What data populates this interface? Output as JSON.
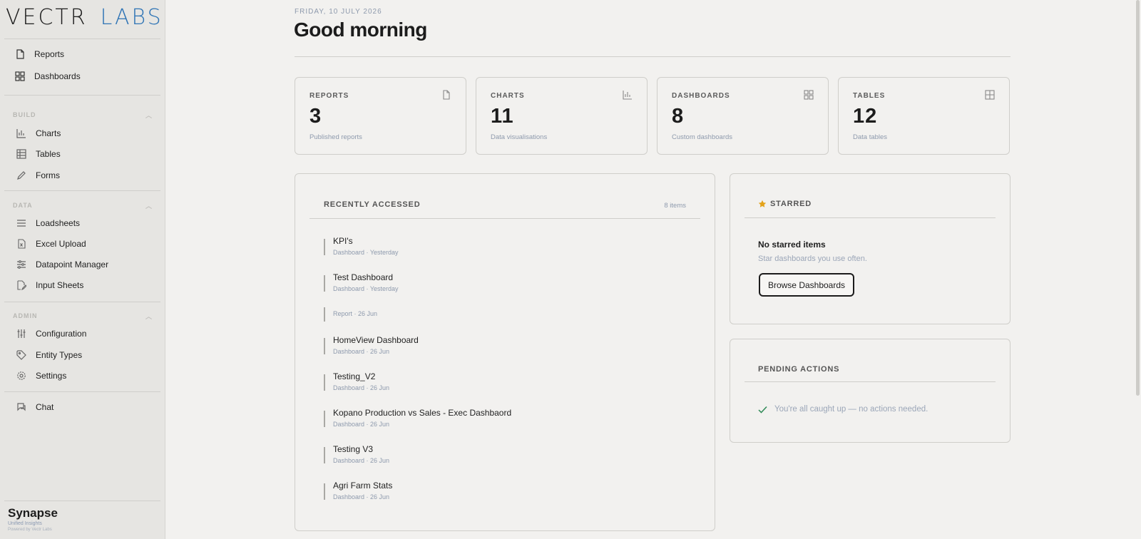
{
  "brand": {
    "logo_left": "VECTR",
    "logo_right": "LABS",
    "app_name": "Synapse",
    "tagline": "Unified Insights",
    "powered_by": "Powered by Vectr Labs"
  },
  "sidebar": {
    "top_items": [
      {
        "label": "Reports",
        "icon": "document-icon"
      },
      {
        "label": "Dashboards",
        "icon": "grid-icon"
      }
    ],
    "sections": [
      {
        "title": "BUILD",
        "items": [
          {
            "label": "Charts",
            "icon": "bar-chart-icon"
          },
          {
            "label": "Tables",
            "icon": "table-icon"
          },
          {
            "label": "Forms",
            "icon": "pencil-icon"
          }
        ]
      },
      {
        "title": "DATA",
        "items": [
          {
            "label": "Loadsheets",
            "icon": "list-icon"
          },
          {
            "label": "Excel Upload",
            "icon": "excel-file-icon"
          },
          {
            "label": "Datapoint Manager",
            "icon": "sliders-icon"
          },
          {
            "label": "Input Sheets",
            "icon": "edit-file-icon"
          }
        ]
      },
      {
        "title": "ADMIN",
        "items": [
          {
            "label": "Configuration",
            "icon": "config-sliders-icon"
          },
          {
            "label": "Entity Types",
            "icon": "tag-icon"
          },
          {
            "label": "Settings",
            "icon": "gear-icon"
          }
        ]
      }
    ],
    "chat": {
      "label": "Chat",
      "icon": "chat-icon"
    }
  },
  "header": {
    "date": "FRIDAY, 10 JULY 2026",
    "greeting": "Good morning"
  },
  "stats": [
    {
      "label": "REPORTS",
      "value": "3",
      "sub": "Published reports",
      "icon": "document-icon"
    },
    {
      "label": "CHARTS",
      "value": "11",
      "sub": "Data visualisations",
      "icon": "bar-chart-icon"
    },
    {
      "label": "DASHBOARDS",
      "value": "8",
      "sub": "Custom dashboards",
      "icon": "grid-icon"
    },
    {
      "label": "TABLES",
      "value": "12",
      "sub": "Data tables",
      "icon": "table-icon"
    }
  ],
  "recent": {
    "title": "RECENTLY ACCESSED",
    "count": "8 items",
    "items": [
      {
        "title": "KPI's",
        "meta": "Dashboard · Yesterday"
      },
      {
        "title": "Test Dashboard",
        "meta": "Dashboard · Yesterday"
      },
      {
        "title": "",
        "meta": "Report · 26 Jun"
      },
      {
        "title": "HomeView Dashboard",
        "meta": "Dashboard · 26 Jun"
      },
      {
        "title": "Testing_V2",
        "meta": "Dashboard · 26 Jun"
      },
      {
        "title": "Kopano Production vs Sales - Exec Dashbaord",
        "meta": "Dashboard · 26 Jun"
      },
      {
        "title": "Testing V3",
        "meta": "Dashboard · 26 Jun"
      },
      {
        "title": "Agri Farm Stats",
        "meta": "Dashboard · 26 Jun"
      }
    ]
  },
  "starred": {
    "title": "STARRED",
    "empty_title": "No starred items",
    "empty_sub": "Star dashboards you use often.",
    "button": "Browse Dashboards"
  },
  "pending": {
    "title": "PENDING ACTIONS",
    "message": "You're all caught up — no actions needed."
  },
  "colors": {
    "accent_blue": "#2f74b5",
    "star": "#e3a21a",
    "check": "#2f8a57"
  }
}
